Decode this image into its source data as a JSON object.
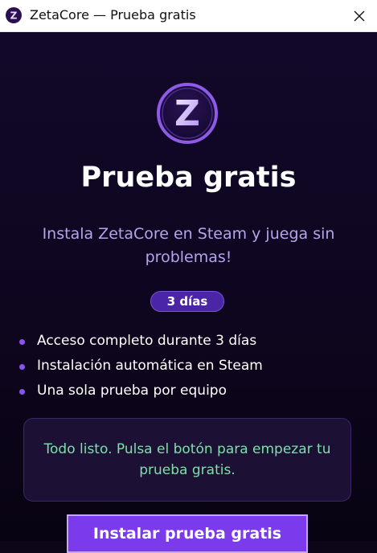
{
  "window": {
    "title": "ZetaCore — Prueba gratis",
    "app_icon": "zetacore-logo-icon",
    "close_icon": "close-icon"
  },
  "logo": {
    "letter": "Z",
    "icon": "zetacore-logo-icon"
  },
  "heading": "Prueba gratis",
  "subtitle": "Instala ZetaCore en Steam y juega sin problemas!",
  "badge": "3 días",
  "features": [
    "Acceso completo durante 3 días",
    "Instalación automática en Steam",
    "Una sola prueba por equipo"
  ],
  "status": {
    "message": "Todo listo. Pulsa el botón para empezar tu prueba gratis.",
    "color": "#7ee0a8"
  },
  "install_button": {
    "label": "Instalar prueba gratis"
  },
  "colors": {
    "accent": "#7c3aed",
    "background": "#0d0618",
    "subtitle": "#b7a3ec"
  }
}
